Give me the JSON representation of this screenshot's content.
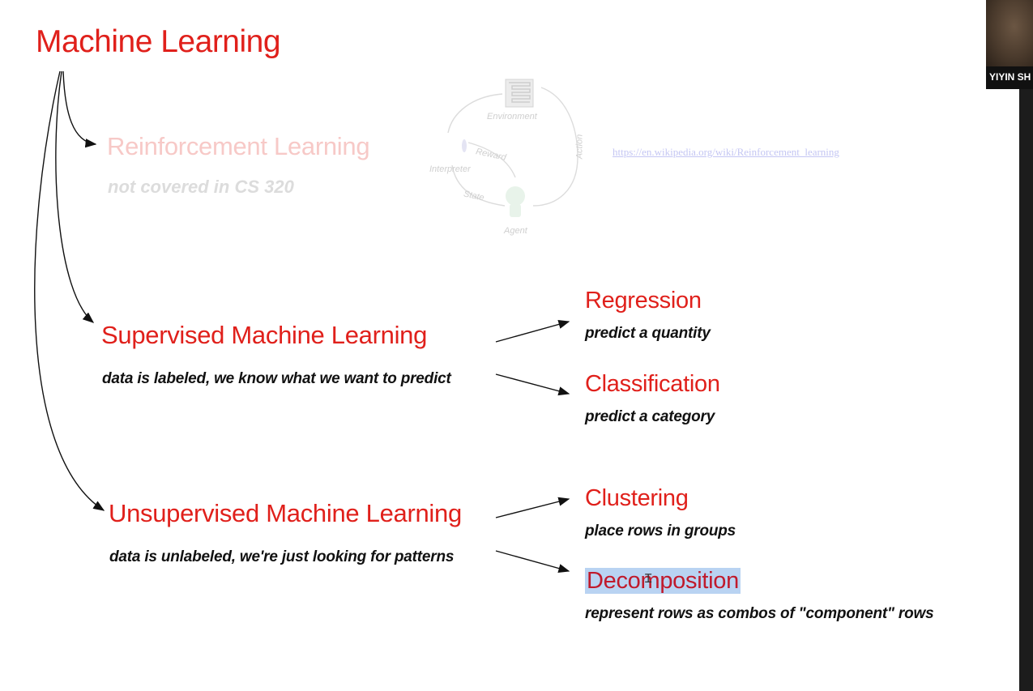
{
  "slide": {
    "title": "Machine Learning",
    "reinforcement": {
      "heading": "Reinforcement Learning",
      "desc": "not covered in CS 320",
      "link": "https://en.wikipedia.org/wiki/Reinforcement_learning",
      "diagram": {
        "environment": "Environment",
        "reward": "Reward",
        "interpreter": "Interpreter",
        "action": "Action",
        "state": "State",
        "agent": "Agent"
      }
    },
    "supervised": {
      "heading": "Supervised Machine Learning",
      "desc": "data is labeled, we know what we want to predict",
      "children": [
        {
          "heading": "Regression",
          "desc": "predict a quantity"
        },
        {
          "heading": "Classification",
          "desc": "predict a category"
        }
      ]
    },
    "unsupervised": {
      "heading": "Unsupervised Machine Learning",
      "desc": "data is unlabeled, we're just looking for patterns",
      "children": [
        {
          "heading": "Clustering",
          "desc": "place rows in groups"
        },
        {
          "heading": "Decomposition",
          "desc": "represent rows as combos of \"component\" rows"
        }
      ]
    }
  },
  "participant": {
    "name": "YIYIN SH"
  },
  "colors": {
    "heading_red": "#e0201b",
    "faded_red": "#f7c9c7",
    "selection_blue": "#b9d3f2"
  }
}
